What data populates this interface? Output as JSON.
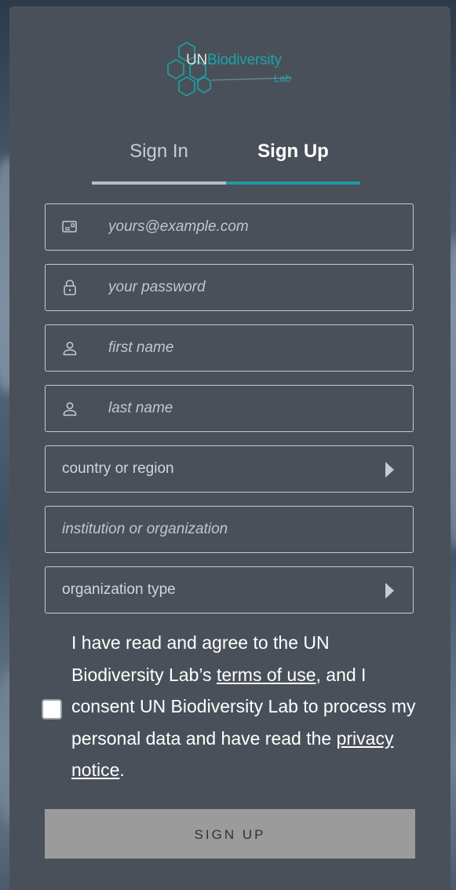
{
  "app": {
    "logo_un": "UN",
    "logo_name": "Biodiversity",
    "logo_lab": "Lab"
  },
  "tabs": [
    {
      "label": "Sign In",
      "active": false
    },
    {
      "label": "Sign Up",
      "active": true
    }
  ],
  "form": {
    "email_placeholder": "yours@example.com",
    "password_placeholder": "your password",
    "first_name_placeholder": "first name",
    "last_name_placeholder": "last name",
    "country_label": "country or region",
    "institution_placeholder": "institution or organization",
    "org_type_label": "organization type"
  },
  "consent": {
    "checked": false,
    "text_1": "I have read and agree to the UN Biodiversity Lab’s ",
    "terms_link": "terms of use",
    "text_2": ", and I consent UN Biodiversity Lab to process my personal data and have read the ",
    "privacy_link": "privacy notice",
    "text_3": "."
  },
  "submit_label": "SIGN UP",
  "colors": {
    "panel": "#4a5059",
    "accent": "#1f9aa5",
    "button": "#9b9b9b"
  },
  "icons": {
    "email": "envelope-icon",
    "password": "lock-icon",
    "first_name": "person-icon",
    "last_name": "person-icon",
    "select": "chevron-right-icon"
  }
}
